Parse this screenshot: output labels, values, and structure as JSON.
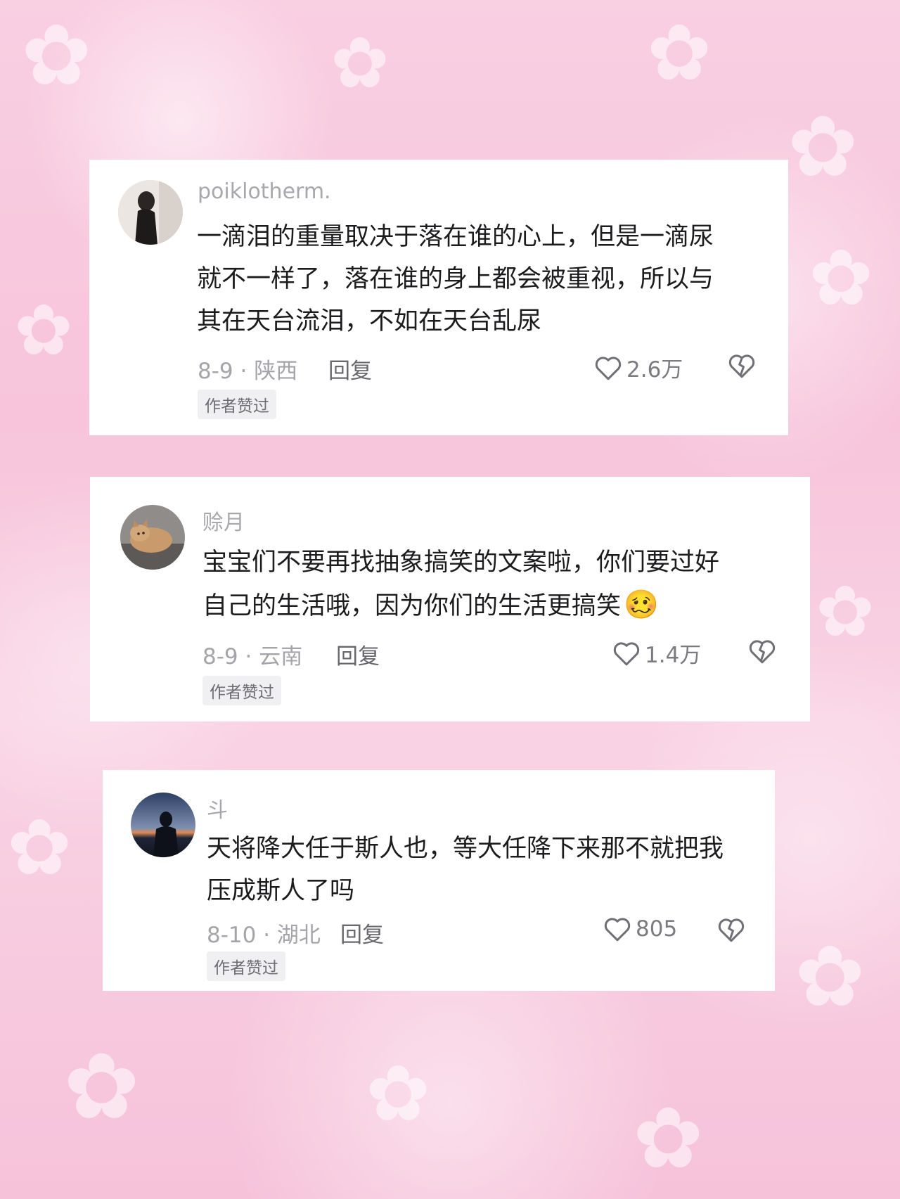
{
  "colors": {
    "background": "#f7c4db",
    "card": "#ffffff",
    "username": "#a7a7ad",
    "comment_text": "#1c1c1e",
    "meta": "#a4a4aa",
    "badge_bg": "#f0f0f2"
  },
  "comments": [
    {
      "username": "poiklotherm.",
      "line1": "一滴泪的重量取决于落在谁的心上，但是一滴尿",
      "line2": "就不一样了，落在谁的身上都会被重视，所以与",
      "line3": "其在天台流泪，不如在天台乱尿",
      "meta": "8-9 · 陕西",
      "reply": "回复",
      "likes": "2.6万",
      "badge": "作者赞过",
      "like_icon": "heart-outline-icon",
      "dislike_icon": "broken-heart-icon"
    },
    {
      "username": "赊月",
      "line1": "宝宝们不要再找抽象搞笑的文案啦，你们要过好",
      "line2": "自己的生活哦，因为你们的生活更搞笑",
      "emoji": "🥴",
      "meta": "8-9 · 云南",
      "reply": "回复",
      "likes": "1.4万",
      "badge": "作者赞过",
      "like_icon": "heart-outline-icon",
      "dislike_icon": "broken-heart-icon"
    },
    {
      "username": "斗",
      "line1": "天将降大任于斯人也，等大任降下来那不就把我",
      "line2": "压成斯人了吗",
      "meta": "8-10 · 湖北",
      "reply": "回复",
      "likes": "805",
      "badge": "作者赞过",
      "like_icon": "heart-outline-icon",
      "dislike_icon": "broken-heart-icon"
    }
  ]
}
